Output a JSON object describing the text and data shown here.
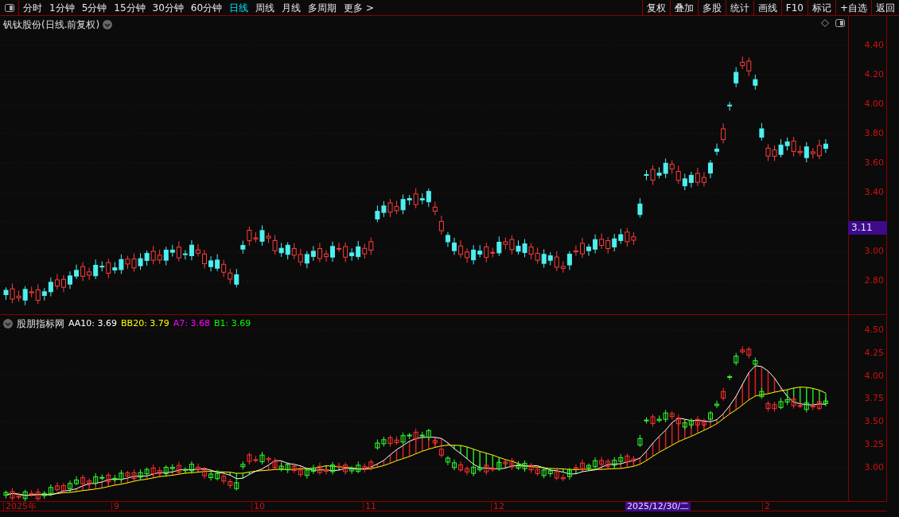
{
  "periods": [
    {
      "label": "分时",
      "selected": false
    },
    {
      "label": "1分钟",
      "selected": false
    },
    {
      "label": "5分钟",
      "selected": false
    },
    {
      "label": "15分钟",
      "selected": false
    },
    {
      "label": "30分钟",
      "selected": false
    },
    {
      "label": "60分钟",
      "selected": false
    },
    {
      "label": "日线",
      "selected": true
    },
    {
      "label": "周线",
      "selected": false
    },
    {
      "label": "月线",
      "selected": false
    },
    {
      "label": "多周期",
      "selected": false
    },
    {
      "label": "更多 >",
      "selected": false
    }
  ],
  "tools": [
    "复权",
    "叠加",
    "多股",
    "统计",
    "画线",
    "F10",
    "标记",
    "+自选",
    "返回"
  ],
  "main_chart": {
    "title": "钒钛股份(日线.前复权)",
    "price_ticks": [
      "4.40",
      "4.20",
      "4.00",
      "3.80",
      "3.60",
      "3.40",
      "3.00",
      "2.80"
    ],
    "current_price": "3.11"
  },
  "indicator": {
    "name": "股朋指标网",
    "legend": [
      {
        "text": "AA10: 3.69",
        "color": "#ffffff"
      },
      {
        "text": "BB20: 3.79",
        "color": "#ffff00"
      },
      {
        "text": "A7: 3.68",
        "color": "#ff00ff"
      },
      {
        "text": "B1: 3.69",
        "color": "#00ff00"
      }
    ],
    "ticks": [
      "4.50",
      "4.25",
      "4.00",
      "3.75",
      "3.50",
      "3.25",
      "3.00"
    ]
  },
  "time_axis": {
    "labels": [
      "2025年",
      "9",
      "10",
      "11",
      "12",
      "2"
    ],
    "cursor_date": "2025/12/30/二"
  }
}
